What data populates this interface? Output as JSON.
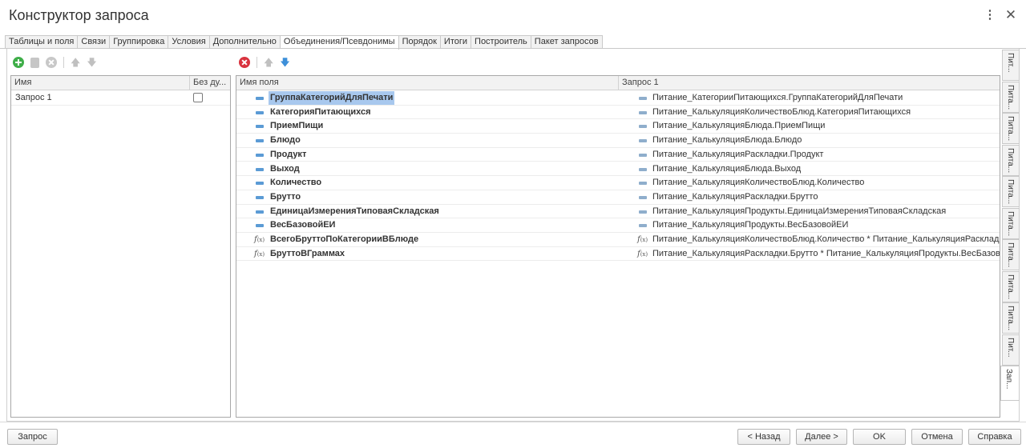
{
  "window": {
    "title": "Конструктор запроса",
    "more_icon": "more-vertical-icon",
    "close_icon": "close-icon"
  },
  "tabs": [
    {
      "label": "Таблицы и поля"
    },
    {
      "label": "Связи"
    },
    {
      "label": "Группировка"
    },
    {
      "label": "Условия"
    },
    {
      "label": "Дополнительно"
    },
    {
      "label": "Объединения/Псевдонимы",
      "active": true
    },
    {
      "label": "Порядок"
    },
    {
      "label": "Итоги"
    },
    {
      "label": "Построитель"
    },
    {
      "label": "Пакет запросов"
    }
  ],
  "left_toolbar": {
    "icons": [
      "add-icon",
      "copy-icon",
      "delete-icon",
      "move-up-icon",
      "move-down-icon"
    ]
  },
  "right_toolbar": {
    "icons": [
      "delete-icon",
      "move-up-icon",
      "move-down-icon"
    ]
  },
  "queries_table": {
    "columns": [
      "Имя",
      "Без ду..."
    ],
    "rows": [
      {
        "name": "Запрос 1",
        "no_duplicates": false
      }
    ]
  },
  "aliases_table": {
    "columns": [
      "Имя поля",
      "Запрос 1"
    ],
    "rows": [
      {
        "kind": "field",
        "name": "ГруппаКатегорийДляПечати",
        "source_kind": "field",
        "source": "Питание_КатегорииПитающихся.ГруппаКатегорийДляПечати",
        "selected": true
      },
      {
        "kind": "field",
        "name": "КатегорияПитающихся",
        "source_kind": "field",
        "source": "Питание_КалькуляцияКоличествоБлюд.КатегорияПитающихся"
      },
      {
        "kind": "field",
        "name": "ПриемПищи",
        "source_kind": "field",
        "source": "Питание_КалькуляцияБлюда.ПриемПищи"
      },
      {
        "kind": "field",
        "name": "Блюдо",
        "source_kind": "field",
        "source": "Питание_КалькуляцияБлюда.Блюдо"
      },
      {
        "kind": "field",
        "name": "Продукт",
        "source_kind": "field",
        "source": "Питание_КалькуляцияРаскладки.Продукт"
      },
      {
        "kind": "field",
        "name": "Выход",
        "source_kind": "field",
        "source": "Питание_КалькуляцияБлюда.Выход"
      },
      {
        "kind": "field",
        "name": "Количество",
        "source_kind": "field",
        "source": "Питание_КалькуляцияКоличествоБлюд.Количество"
      },
      {
        "kind": "field",
        "name": "Брутто",
        "source_kind": "field",
        "source": "Питание_КалькуляцияРаскладки.Брутто"
      },
      {
        "kind": "field",
        "name": "ЕдиницаИзмеренияТиповаяСкладская",
        "source_kind": "field",
        "source": "Питание_КалькуляцияПродукты.ЕдиницаИзмеренияТиповаяСкладская"
      },
      {
        "kind": "field",
        "name": "ВесБазовойЕИ",
        "source_kind": "field",
        "source": "Питание_КалькуляцияПродукты.ВесБазовойЕИ"
      },
      {
        "kind": "expression",
        "name": "ВсегоБруттоПоКатегорииВБлюде",
        "source_kind": "expression",
        "source": "Питание_КалькуляцияКоличествоБлюд.Количество * Питание_КалькуляцияРаскладки.Б..."
      },
      {
        "kind": "expression",
        "name": "БруттоВГраммах",
        "source_kind": "expression",
        "source": "Питание_КалькуляцияРаскладки.Брутто * Питание_КалькуляцияПродукты.ВесБазовойЕ..."
      }
    ]
  },
  "side_tabs": [
    "Пит...",
    "Пита...",
    "Пита...",
    "Пита...",
    "Пита...",
    "Пита...",
    "Пита...",
    "Пита...",
    "Пита...",
    "Пит...",
    "Зап..."
  ],
  "footer": {
    "query_button": "Запрос",
    "back_button": "< Назад",
    "next_button": "Далее >",
    "ok_button": "OK",
    "cancel_button": "Отмена",
    "help_button": "Справка"
  },
  "colors": {
    "selection": "#a8c8ee",
    "field_icon": "#5b9bd5",
    "add_icon": "#3fae49",
    "delete_icon": "#d9333f",
    "arrow_down_active": "#3d8fd9"
  }
}
